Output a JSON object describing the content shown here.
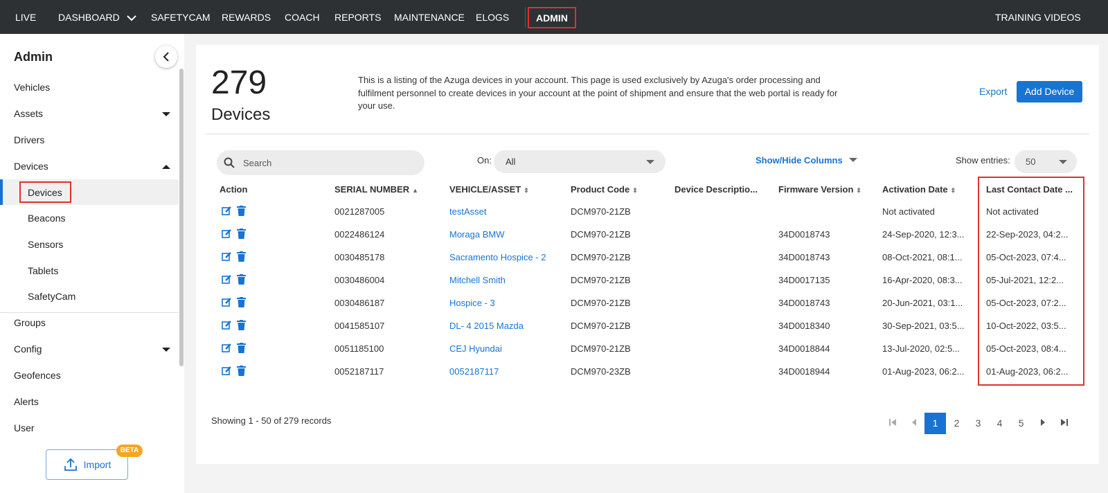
{
  "nav": {
    "items": [
      "LIVE",
      "DASHBOARD",
      "SAFETYCAM",
      "REWARDS",
      "COACH",
      "REPORTS",
      "MAINTENANCE",
      "ELOGS"
    ],
    "active": "ADMIN",
    "training": "TRAINING VIDEOS"
  },
  "sidebar": {
    "title": "Admin",
    "items": [
      "Vehicles",
      "Assets",
      "Drivers",
      "Devices",
      "Groups",
      "Config",
      "Geofences",
      "Alerts",
      "User"
    ],
    "sub_items": [
      "Devices",
      "Beacons",
      "Sensors",
      "Tablets",
      "SafetyCam"
    ],
    "import_label": "Import",
    "beta_label": "BETA"
  },
  "header": {
    "count": "279",
    "count_label": "Devices",
    "description": "This is a listing of the Azuga devices in your account. This page is used exclusively by Azuga's order processing and fulfilment personnel to create devices in your account at the point of shipment and ensure that the web portal is ready for your use.",
    "export_label": "Export",
    "add_label": "Add Device"
  },
  "filters": {
    "search_placeholder": "Search",
    "on_label": "On:",
    "on_value": "All",
    "show_hide_label": "Show/Hide Columns",
    "entries_label": "Show entries:",
    "entries_value": "50"
  },
  "table": {
    "columns": [
      "Action",
      "SERIAL NUMBER",
      "VEHICLE/ASSET",
      "Product Code",
      "Device Descriptio...",
      "Firmware Version",
      "Activation Date",
      "Last Contact Date ..."
    ],
    "rows": [
      {
        "serial": "0021287005",
        "asset": "testAsset",
        "product": "DCM970-21ZB",
        "description": "",
        "firmware": "",
        "activation": "Not activated",
        "last_contact": "Not activated"
      },
      {
        "serial": "0022486124",
        "asset": "Moraga BMW",
        "product": "DCM970-21ZB",
        "description": "",
        "firmware": "34D0018743",
        "activation": "24-Sep-2020, 12:3...",
        "last_contact": "22-Sep-2023, 04:2..."
      },
      {
        "serial": "0030485178",
        "asset": "Sacramento Hospice - 2",
        "product": "DCM970-21ZB",
        "description": "",
        "firmware": "34D0018743",
        "activation": "08-Oct-2021, 08:1...",
        "last_contact": "05-Oct-2023, 07:4..."
      },
      {
        "serial": "0030486004",
        "asset": "Mitchell Smith",
        "product": "DCM970-21ZB",
        "description": "",
        "firmware": "34D0017135",
        "activation": "16-Apr-2020, 08:3...",
        "last_contact": "05-Jul-2021, 12:2..."
      },
      {
        "serial": "0030486187",
        "asset": "Hospice - 3",
        "product": "DCM970-21ZB",
        "description": "",
        "firmware": "34D0018743",
        "activation": "20-Jun-2021, 03:1...",
        "last_contact": "05-Oct-2023, 07:2..."
      },
      {
        "serial": "0041585107",
        "asset": "DL- 4 2015 Mazda",
        "product": "DCM970-21ZB",
        "description": "",
        "firmware": "34D0018340",
        "activation": "30-Sep-2021, 03:5...",
        "last_contact": "10-Oct-2022, 03:5..."
      },
      {
        "serial": "0051185100",
        "asset": "CEJ Hyundai",
        "product": "DCM970-21ZB",
        "description": "",
        "firmware": "34D0018844",
        "activation": "13-Jul-2020, 02:5...",
        "last_contact": "05-Oct-2023, 08:4..."
      },
      {
        "serial": "0052187117",
        "asset": "0052187117",
        "product": "DCM970-23ZB",
        "description": "",
        "firmware": "34D0018944",
        "activation": "01-Aug-2023, 06:2...",
        "last_contact": "01-Aug-2023, 06:2..."
      }
    ]
  },
  "pagination": {
    "records": "Showing 1 - 50 of 279 records",
    "pages": [
      "1",
      "2",
      "3",
      "4",
      "5"
    ],
    "current": "1"
  },
  "colors": {
    "accent": "#1873d3",
    "nav_bg": "#2d3134",
    "highlight": "#e0302a",
    "beta": "#f5a623"
  }
}
